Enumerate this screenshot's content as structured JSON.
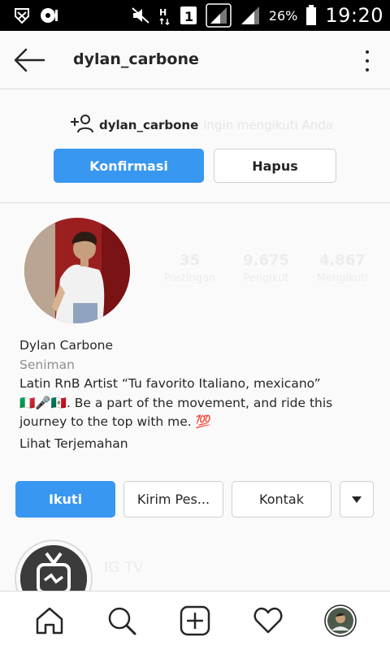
{
  "status_bar": {
    "battery_percent": "26%",
    "time": "19:20"
  },
  "header": {
    "username": "dylan_carbone"
  },
  "follow_request": {
    "username": "dylan_carbone",
    "text": "ingin mengikuti Anda",
    "confirm_label": "Konfirmasi",
    "delete_label": "Hapus"
  },
  "profile": {
    "stats": [
      {
        "value": "35",
        "label": "Postingan"
      },
      {
        "value": "9.675",
        "label": "Pengikut"
      },
      {
        "value": "4.867",
        "label": "Mengikuti"
      }
    ],
    "name": "Dylan Carbone",
    "category": "Seniman",
    "bio_line1": "Latin RnB Artist “Tu favorito Italiano, mexicano”",
    "bio_line2": "🇮🇹🎤🇲🇽. Be a part of the movement, and ride this",
    "bio_line3": "journey to the top with me. 💯",
    "translate_label": "Lihat Terjemahan"
  },
  "actions": {
    "follow_label": "Ikuti",
    "message_label": "Kirim Pes...",
    "contact_label": "Kontak"
  },
  "highlight": {
    "title": "IG TV"
  },
  "colors": {
    "accent": "#3897f0",
    "border": "#dbdbdb",
    "muted": "#8e8e8e"
  },
  "nav": [
    "home-icon",
    "search-icon",
    "add-post-icon",
    "heart-icon",
    "profile-avatar"
  ]
}
